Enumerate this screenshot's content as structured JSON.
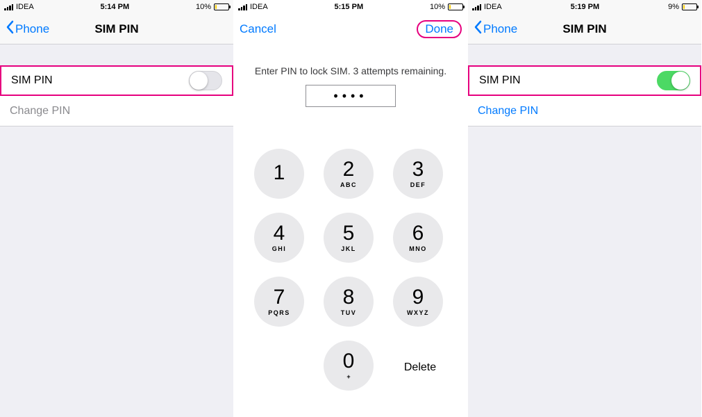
{
  "screen1": {
    "status": {
      "carrier": "IDEA",
      "time": "5:14 PM",
      "battery": "10%"
    },
    "nav": {
      "back": "Phone",
      "title": "SIM PIN"
    },
    "rows": {
      "sim_pin_label": "SIM PIN",
      "change_pin_label": "Change PIN",
      "switch_on": false
    }
  },
  "screen2": {
    "status": {
      "carrier": "IDEA",
      "time": "5:15 PM",
      "battery": "10%"
    },
    "nav": {
      "cancel": "Cancel",
      "done": "Done"
    },
    "prompt": "Enter PIN to lock SIM. 3 attempts remaining.",
    "pin_masked": "••••",
    "delete_label": "Delete",
    "keypad": [
      {
        "digit": "1",
        "letters": ""
      },
      {
        "digit": "2",
        "letters": "ABC"
      },
      {
        "digit": "3",
        "letters": "DEF"
      },
      {
        "digit": "4",
        "letters": "GHI"
      },
      {
        "digit": "5",
        "letters": "JKL"
      },
      {
        "digit": "6",
        "letters": "MNO"
      },
      {
        "digit": "7",
        "letters": "PQRS"
      },
      {
        "digit": "8",
        "letters": "TUV"
      },
      {
        "digit": "9",
        "letters": "WXYZ"
      },
      {
        "digit": "0",
        "letters": "+"
      }
    ]
  },
  "screen3": {
    "status": {
      "carrier": "IDEA",
      "time": "5:19 PM",
      "battery": "9%"
    },
    "nav": {
      "back": "Phone",
      "title": "SIM PIN"
    },
    "rows": {
      "sim_pin_label": "SIM PIN",
      "change_pin_label": "Change PIN",
      "switch_on": true
    }
  }
}
